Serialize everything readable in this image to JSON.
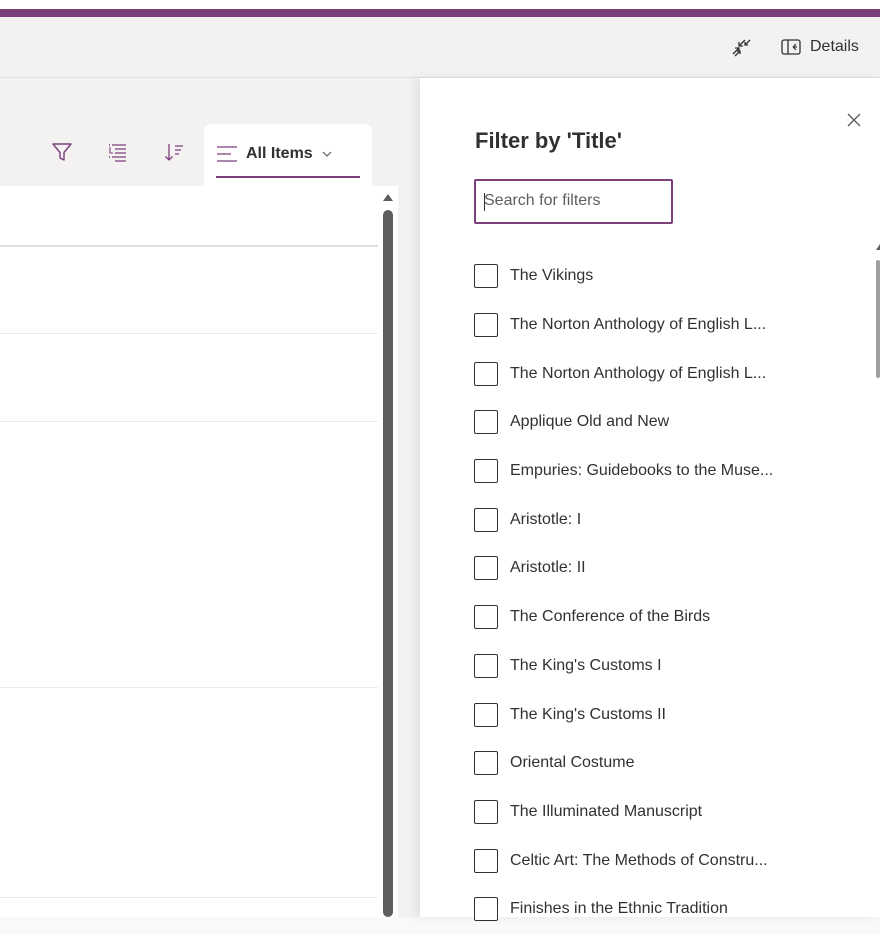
{
  "command_bar": {
    "collapse_icon": "collapse-arrows-icon",
    "details_icon": "details-panel-icon",
    "details_label": "Details"
  },
  "view_bar": {
    "icons": [
      "filter-icon",
      "group-list-icon",
      "sort-icon",
      "view-lines-icon",
      "chevron-down-icon"
    ],
    "current_view_label": "All Items"
  },
  "filter_panel": {
    "title": "Filter by 'Title'",
    "close_icon": "close-icon",
    "search_placeholder": "Search for filters",
    "search_value": "",
    "options": [
      "The Vikings",
      "The Norton Anthology of English L...",
      "The Norton Anthology of English L...",
      "Applique Old and New",
      "Empuries: Guidebooks to the Muse...",
      "Aristotle: I",
      "Aristotle: II",
      "The Conference of the Birds",
      "The King's Customs I",
      "The King's Customs II",
      "Oriental Costume",
      "The Illuminated Manuscript",
      "Celtic Art: The Methods of Constru...",
      "Finishes in the Ethnic Tradition"
    ]
  },
  "colors": {
    "accent": "#7b3f7c",
    "surface": "#f3f2f1",
    "text": "#323130"
  }
}
